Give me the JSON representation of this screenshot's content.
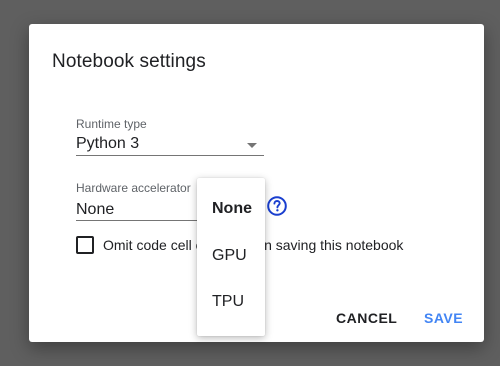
{
  "dialog": {
    "title": "Notebook settings",
    "runtime": {
      "label": "Runtime type",
      "value": "Python 3"
    },
    "accelerator": {
      "label": "Hardware accelerator",
      "value": "None",
      "options": [
        "None",
        "GPU",
        "TPU"
      ],
      "selected": "None"
    },
    "omit_output": {
      "label": "Omit code cell output when saving this notebook",
      "checked": false
    },
    "buttons": {
      "cancel": "CANCEL",
      "save": "SAVE"
    }
  },
  "colors": {
    "backdrop": "#5f5f5f",
    "accent": "#4285f4",
    "help_icon": "#1a3fcf",
    "text": "#202124"
  },
  "icons": {
    "dropdown": "triangle-down",
    "help": "question-circle"
  }
}
